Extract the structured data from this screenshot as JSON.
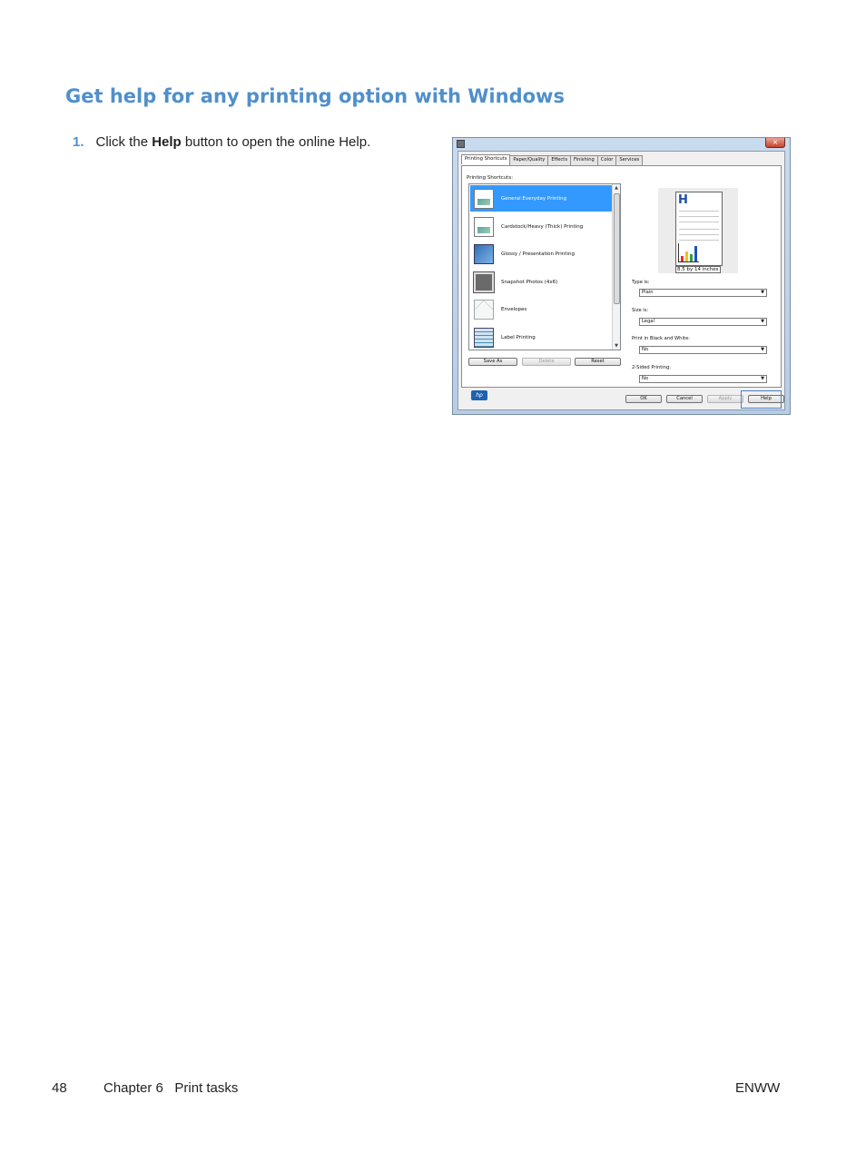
{
  "heading": "Get help for any printing option with Windows",
  "step": {
    "number": "1.",
    "before": "Click the",
    "bold": "Help",
    "after": "button to open the online Help."
  },
  "dialog": {
    "tabs": [
      "Printing Shortcuts",
      "Paper/Quality",
      "Effects",
      "Finishing",
      "Color",
      "Services"
    ],
    "shortcuts_label": "Printing Shortcuts:",
    "shortcuts": [
      {
        "label": "General Everyday Printing",
        "icon": "document-icon",
        "selected": true
      },
      {
        "label": "Cardstock/Heavy (Thick) Printing",
        "icon": "document-icon",
        "selected": false
      },
      {
        "label": "Glossy / Presentation Printing",
        "icon": "glossy-icon",
        "selected": false
      },
      {
        "label": "Snapshot Photos (4x6)",
        "icon": "photo-icon",
        "selected": false
      },
      {
        "label": "Envelopes",
        "icon": "envelope-icon",
        "selected": false
      },
      {
        "label": "Label Printing",
        "icon": "label-icon",
        "selected": false
      }
    ],
    "buttons": {
      "save_as": "Save As",
      "delete": "Delete",
      "reset": "Reset"
    },
    "logo": "hp",
    "preview_caption": "8.5 by 14 inches",
    "fields": [
      {
        "label": "Type is:",
        "value": "Plain"
      },
      {
        "label": "Size is:",
        "value": "Legal"
      },
      {
        "label": "Print in Black and White:",
        "value": "No"
      },
      {
        "label": "2-Sided Printing:",
        "value": "No"
      }
    ],
    "bottom_buttons": {
      "ok": "OK",
      "cancel": "Cancel",
      "apply": "Apply",
      "help": "Help"
    },
    "close": "×"
  },
  "footer": {
    "page_number": "48",
    "chapter": "Chapter 6   Print tasks",
    "right": "ENWW"
  }
}
